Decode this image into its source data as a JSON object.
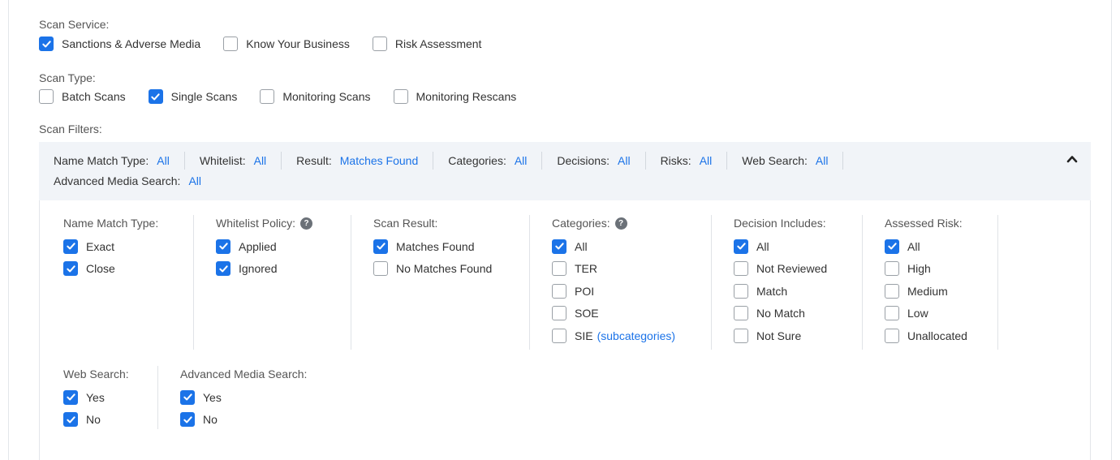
{
  "scan_service": {
    "label": "Scan Service:",
    "options": [
      {
        "label": "Sanctions & Adverse Media",
        "checked": true
      },
      {
        "label": "Know Your Business",
        "checked": false
      },
      {
        "label": "Risk Assessment",
        "checked": false
      }
    ]
  },
  "scan_type": {
    "label": "Scan Type:",
    "options": [
      {
        "label": "Batch Scans",
        "checked": false
      },
      {
        "label": "Single Scans",
        "checked": true
      },
      {
        "label": "Monitoring Scans",
        "checked": false
      },
      {
        "label": "Monitoring Rescans",
        "checked": false
      }
    ]
  },
  "scan_filters": {
    "label": "Scan Filters:",
    "summary": [
      {
        "key": "Name Match Type:",
        "value": "All"
      },
      {
        "key": "Whitelist:",
        "value": "All"
      },
      {
        "key": "Result:",
        "value": "Matches Found"
      },
      {
        "key": "Categories:",
        "value": "All"
      },
      {
        "key": "Decisions:",
        "value": "All"
      },
      {
        "key": "Risks:",
        "value": "All"
      },
      {
        "key": "Web Search:",
        "value": "All"
      },
      {
        "key": "Advanced Media Search:",
        "value": "All"
      }
    ],
    "collapse_icon": "chevron-up-icon"
  },
  "filter_groups": {
    "name_match_type": {
      "title": "Name Match Type:",
      "options": [
        {
          "label": "Exact",
          "checked": true
        },
        {
          "label": "Close",
          "checked": true
        }
      ]
    },
    "whitelist_policy": {
      "title": "Whitelist Policy:",
      "help": "?",
      "options": [
        {
          "label": "Applied",
          "checked": true
        },
        {
          "label": "Ignored",
          "checked": true
        }
      ]
    },
    "scan_result": {
      "title": "Scan Result:",
      "options": [
        {
          "label": "Matches Found",
          "checked": true
        },
        {
          "label": "No Matches Found",
          "checked": false
        }
      ]
    },
    "categories": {
      "title": "Categories:",
      "help": "?",
      "options": [
        {
          "label": "All",
          "checked": true
        },
        {
          "label": "TER",
          "checked": false
        },
        {
          "label": "POI",
          "checked": false
        },
        {
          "label": "SOE",
          "checked": false
        },
        {
          "label": "SIE",
          "checked": false
        }
      ],
      "sie_link": "(subcategories)"
    },
    "decision_includes": {
      "title": "Decision Includes:",
      "options": [
        {
          "label": "All",
          "checked": true
        },
        {
          "label": "Not Reviewed",
          "checked": false
        },
        {
          "label": "Match",
          "checked": false
        },
        {
          "label": "No Match",
          "checked": false
        },
        {
          "label": "Not Sure",
          "checked": false
        }
      ]
    },
    "assessed_risk": {
      "title": "Assessed Risk:",
      "options": [
        {
          "label": "All",
          "checked": true
        },
        {
          "label": "High",
          "checked": false
        },
        {
          "label": "Medium",
          "checked": false
        },
        {
          "label": "Low",
          "checked": false
        },
        {
          "label": "Unallocated",
          "checked": false
        }
      ]
    },
    "web_search": {
      "title": "Web Search:",
      "options": [
        {
          "label": "Yes",
          "checked": true
        },
        {
          "label": "No",
          "checked": true
        }
      ]
    },
    "advanced_media_search": {
      "title": "Advanced Media Search:",
      "options": [
        {
          "label": "Yes",
          "checked": true
        },
        {
          "label": "No",
          "checked": true
        }
      ]
    }
  },
  "colors": {
    "accent": "#1b73e8",
    "filter_bar_bg": "#f1f4f8"
  }
}
